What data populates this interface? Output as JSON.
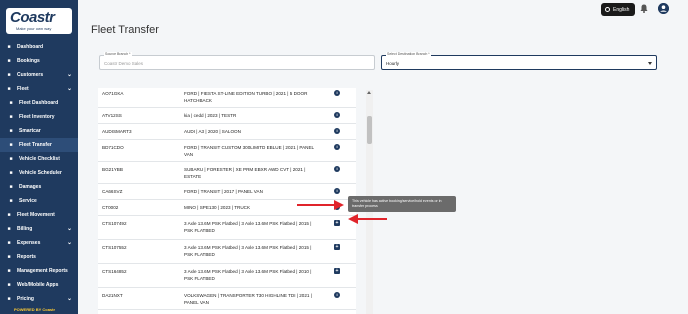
{
  "sidebar": {
    "brand": "Coastr",
    "tagline": "Make your own way",
    "items": [
      {
        "label": "Dashboard",
        "icon": "dashboard-icon",
        "sub": false,
        "chev": false
      },
      {
        "label": "Bookings",
        "icon": "bookings-icon",
        "sub": false,
        "chev": false
      },
      {
        "label": "Customers",
        "icon": "customers-icon",
        "sub": false,
        "chev": true
      },
      {
        "label": "Fleet",
        "icon": "fleet-icon",
        "sub": false,
        "chev": true
      },
      {
        "label": "Fleet Dashboard",
        "icon": "fleet-dashboard-icon",
        "sub": true,
        "chev": false
      },
      {
        "label": "Fleet Inventory",
        "icon": "fleet-inventory-icon",
        "sub": true,
        "chev": false
      },
      {
        "label": "Smartcar",
        "icon": "smartcar-icon",
        "sub": true,
        "chev": false
      },
      {
        "label": "Fleet Transfer",
        "icon": "fleet-transfer-icon",
        "sub": true,
        "chev": false,
        "active": true
      },
      {
        "label": "Vehicle Checklist",
        "icon": "checklist-icon",
        "sub": true,
        "chev": false
      },
      {
        "label": "Vehicle Scheduler",
        "icon": "scheduler-icon",
        "sub": true,
        "chev": false
      },
      {
        "label": "Damages",
        "icon": "damages-icon",
        "sub": true,
        "chev": false
      },
      {
        "label": "Service",
        "icon": "service-icon",
        "sub": true,
        "chev": false
      },
      {
        "label": "Fleet Movement",
        "icon": "movement-icon",
        "sub": false,
        "chev": false
      },
      {
        "label": "Billing",
        "icon": "billing-icon",
        "sub": false,
        "chev": true
      },
      {
        "label": "Expenses",
        "icon": "expenses-icon",
        "sub": false,
        "chev": true
      },
      {
        "label": "Reports",
        "icon": "reports-icon",
        "sub": false,
        "chev": false
      },
      {
        "label": "Management Reports",
        "icon": "management-reports-icon",
        "sub": false,
        "chev": false
      },
      {
        "label": "Web/Mobile Apps",
        "icon": "apps-icon",
        "sub": false,
        "chev": false
      },
      {
        "label": "Pricing",
        "icon": "pricing-icon",
        "sub": false,
        "chev": true
      }
    ],
    "powered_by": "POWERED BY Coastr"
  },
  "header": {
    "language": "English"
  },
  "page": {
    "title": "Fleet Transfer"
  },
  "source_branch": {
    "label": "Source Branch *",
    "value": "Coastr Demo Sales"
  },
  "destination_branch": {
    "label": "Select Destination Branch *",
    "value": "Hourly"
  },
  "vehicles": [
    {
      "reg": "AO71GKA",
      "desc": "FORD | FIESTA ST-LINE EDITION TURBO | 2021 | 5 DOOR HATCHBACK",
      "action": "info"
    },
    {
      "reg": "ATV12SS",
      "desc": "kia | cedd | 2023 | TESTR",
      "action": "info"
    },
    {
      "reg": "AUDISMART3",
      "desc": "AUDI | A3 | 2020 | SALOON",
      "action": "info"
    },
    {
      "reg": "BD71CDO",
      "desc": "FORD | TRANSIT CUSTOM 300LIMITD EBLUE | 2021 | PANEL VAN",
      "action": "info"
    },
    {
      "reg": "BG21YBB",
      "desc": "SUBARU | FORESTER | XE PRM EBXR AWD CVT | 2021 | ESTATE",
      "action": "info"
    },
    {
      "reg": "CA66SVZ",
      "desc": "FORD | TRANSIT | 2017 | PANEL VAN",
      "action": "info"
    },
    {
      "reg": "CT0002",
      "desc": "MINO | SPE130 | 2023 | TRUCK",
      "action": "info"
    },
    {
      "reg": "CTS107492",
      "desc": "3 Axle 13.6M PSK Flatbed | 3 Axle 13.6M PSK Flatbed | 2015 | PSK FLATBED",
      "action": "add"
    },
    {
      "reg": "CTS107552",
      "desc": "3 Axle 13.6M PSK Flatbed | 3 Axle 13.6M PSK Flatbed | 2015 | PSK FLATBED",
      "action": "add"
    },
    {
      "reg": "CTS164852",
      "desc": "3 Axle 13.6M PSK Flatbed | 3 Axle 13.6M PSK Flatbed | 2010 | PSK FLATBED",
      "action": "add"
    },
    {
      "reg": "DA21NXT",
      "desc": "VOLKSWAGEN | TRANSPORTER T30 HIGHLINE TDI | 2021 | PANEL VAN",
      "action": "info"
    },
    {
      "reg": "DA66ZKH",
      "desc": "TOYOTA | PRIUS | 2016 | MPV",
      "action": "info"
    }
  ],
  "tooltip": {
    "text": "This vehicle has active booking/service/hold events or in transfer process"
  },
  "colors": {
    "sidebar_bg": "#1f3a5f",
    "arrow": "#e0242b"
  }
}
